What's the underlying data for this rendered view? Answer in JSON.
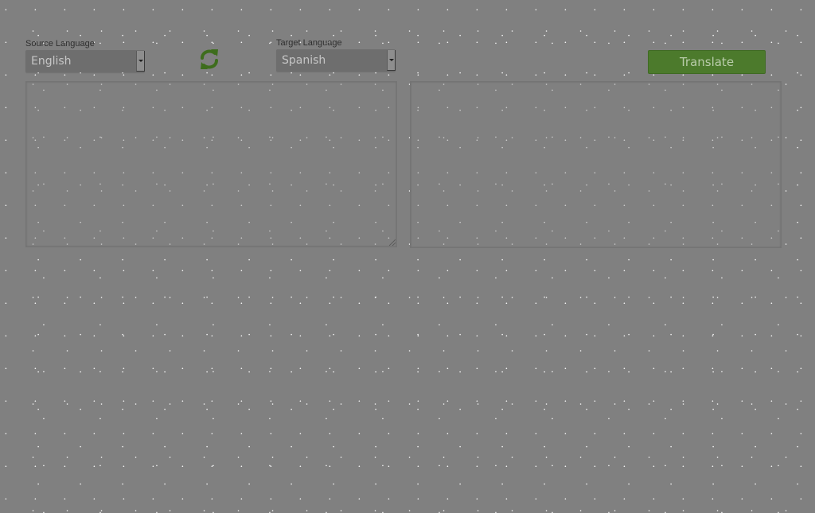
{
  "source": {
    "label": "Source Language",
    "selected": "English"
  },
  "target": {
    "label": "Target Language",
    "selected": "Spanish"
  },
  "actions": {
    "swap_icon": "swap-arrows-icon",
    "translate_label": "Translate"
  },
  "input_text": "",
  "output_text": "",
  "colors": {
    "background": "#808080",
    "accent": "#4c7a2c",
    "swap_icon": "#3e6d1d"
  }
}
